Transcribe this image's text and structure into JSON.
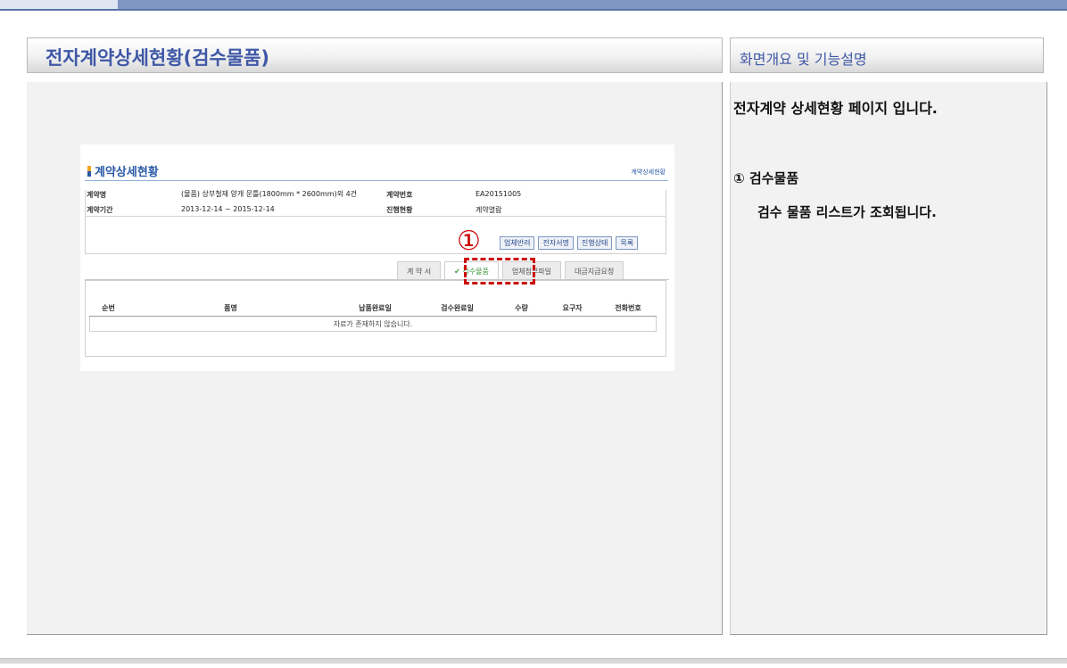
{
  "header": {
    "left_title": "전자계약상세현황(검수물품)",
    "right_title": "화면개요 및 기능설명"
  },
  "description": {
    "intro": "전자계약 상세현황 페이지 입니다.",
    "item_title": "① 검수물품",
    "item_desc": "검수 물품 리스트가 조회됩니다."
  },
  "screen": {
    "title": "계약상세현황",
    "breadcrumb": "계약상세현황",
    "info": {
      "contract_name_label": "계약명",
      "contract_name": "(물품) 상부철재 양개 문틀(1800mm * 2600mm)외 4건",
      "contract_no_label": "계약번호",
      "contract_no": "EA20151005",
      "period_label": "계약기간",
      "period": "2013-12-14 ~ 2015-12-14",
      "status_label": "진행현황",
      "status": "계약열람"
    },
    "buttons": [
      "업체반려",
      "전자서명",
      "진행상태",
      "목록"
    ],
    "tabs": [
      "계 약 서",
      "✔ 검수물품",
      "업체첨부파일",
      "대금지급요청"
    ],
    "table": {
      "headers": [
        "순번",
        "품명",
        "납품완료일",
        "검수완료일",
        "수량",
        "요구자",
        "전화번호"
      ],
      "empty_message": "자료가 존재하지 않습니다."
    }
  },
  "callout": {
    "marker": "①"
  }
}
